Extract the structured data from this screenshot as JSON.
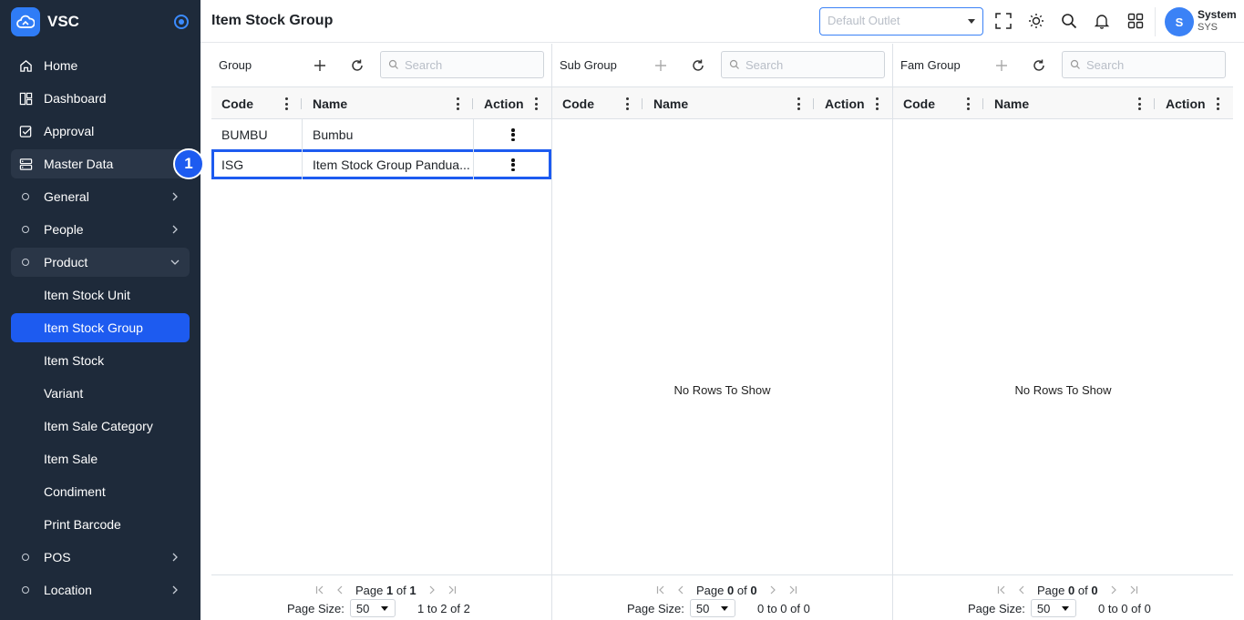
{
  "app": {
    "name": "VSC"
  },
  "sidebar": {
    "items": [
      {
        "label": "Home",
        "icon": "home-icon"
      },
      {
        "label": "Dashboard",
        "icon": "dashboard-icon"
      },
      {
        "label": "Approval",
        "icon": "approval-icon"
      },
      {
        "label": "Master Data",
        "icon": "database-icon"
      },
      {
        "label": "General"
      },
      {
        "label": "People"
      },
      {
        "label": "Product"
      },
      {
        "label": "Item Stock Unit"
      },
      {
        "label": "Item Stock Group"
      },
      {
        "label": "Item Stock"
      },
      {
        "label": "Variant"
      },
      {
        "label": "Item Sale Category"
      },
      {
        "label": "Item Sale"
      },
      {
        "label": "Condiment"
      },
      {
        "label": "Print Barcode"
      },
      {
        "label": "POS"
      },
      {
        "label": "Location"
      }
    ],
    "step_badge": "1"
  },
  "header": {
    "title": "Item Stock Group",
    "outlet_placeholder": "Default Outlet",
    "user": {
      "avatar": "S",
      "name": "System",
      "code": "SYS"
    }
  },
  "panels": [
    {
      "title": "Group",
      "search_placeholder": "Search",
      "columns": [
        "Code",
        "Name",
        "Action"
      ],
      "rows": [
        {
          "code": "BUMBU",
          "name": "Bumbu"
        },
        {
          "code": "ISG",
          "name": "Item Stock Group Pandua..."
        }
      ],
      "pager": {
        "page": "1",
        "of": "1",
        "size": "50",
        "summary": "1 to 2 of 2"
      }
    },
    {
      "title": "Sub Group",
      "search_placeholder": "Search",
      "columns": [
        "Code",
        "Name",
        "Action"
      ],
      "empty": "No Rows To Show",
      "pager": {
        "page": "0",
        "of": "0",
        "size": "50",
        "summary": "0 to 0 of 0"
      }
    },
    {
      "title": "Fam Group",
      "search_placeholder": "Search",
      "columns": [
        "Code",
        "Name",
        "Action"
      ],
      "empty": "No Rows To Show",
      "pager": {
        "page": "0",
        "of": "0",
        "size": "50",
        "summary": "0 to 0 of 0"
      }
    }
  ],
  "labels": {
    "page": "Page",
    "of": "of",
    "page_size": "Page Size:"
  },
  "colors": {
    "sidebar_bg": "#1e2a3a",
    "accent": "#1d5bf0"
  }
}
